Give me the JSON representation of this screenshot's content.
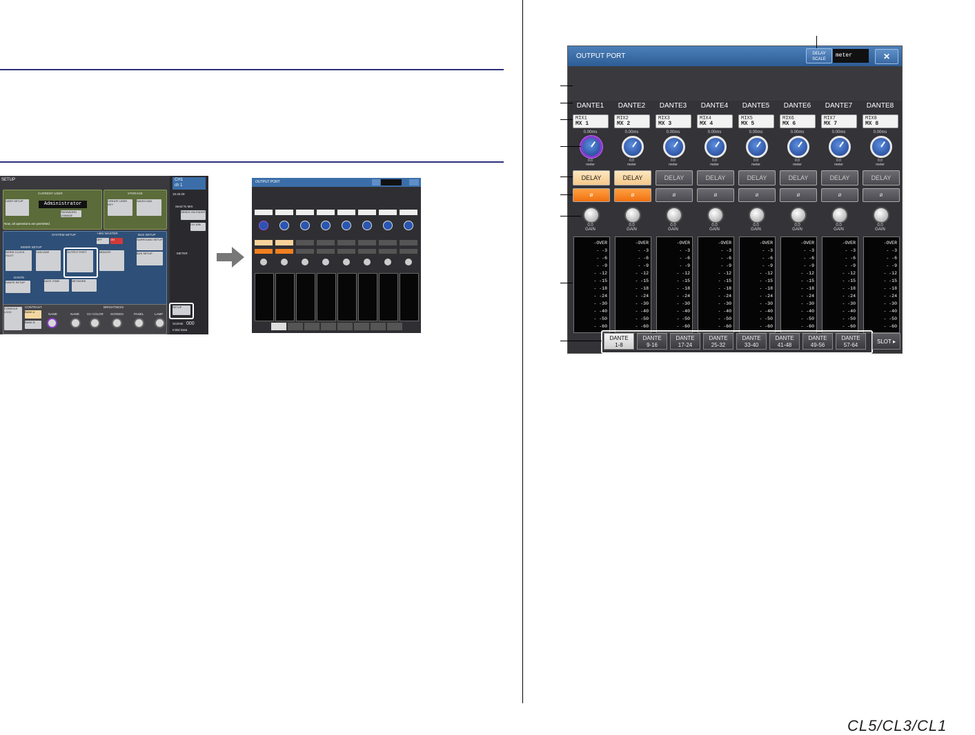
{
  "setup_screen": {
    "title": "SETUP",
    "current_user": "CURRENT USER",
    "storage": "STORAGE",
    "user_setup": "USER SETUP",
    "user_name": "Administrator",
    "password_change": "PASSWORD CHANGE",
    "create_user_key": "CREATE USER KEY",
    "save_load": "SAVE/LOAD",
    "permission_note": "Now, all operations are permitted.",
    "system_setup": "SYSTEM SETUP",
    "mixer_setup": "MIXER SETUP",
    "word_clock": "WORD CLOCK /SLOT",
    "cascade": "CASCADE",
    "output_port": "OUTPUT PORT",
    "midi_gpi": "MIDI/GPI",
    "plus48v_master": "+48V MASTER",
    "off": "OFF",
    "on": "ON",
    "bus_setup": "BUS SETUP",
    "surround_setup": "SURROUND SETUP",
    "bus_setup_btn": "BUS SETUP",
    "dante": "DANTE",
    "dante_setup": "DANTE SETUP",
    "date_time": "DATE /TIME",
    "network": "NETWORK",
    "console_lock": "CONSOLE LOCK",
    "contrast": "CONTRAST",
    "brightness": "BRIGHTNESS",
    "bank_a": "BANK A",
    "bank_b": "BANK B",
    "name": "NAME",
    "ch_color": "CH COLOR",
    "screen": "SCREEN",
    "panel": "PANEL",
    "lamp": "LAMP",
    "setup_btn": "SETUP",
    "ch_id": "CH1",
    "ch_name": "ch 1",
    "time": "15:46:29",
    "send_to_mix": "Send To MIX",
    "sends_on_fader": "SENDS ON FADER",
    "ch_job": "CH JOB",
    "meter": "METER",
    "scene": "SCENE",
    "scene_num": "000",
    "scene_name": "Initial Data"
  },
  "mini_window": {
    "title": "OUTPUT PORT"
  },
  "window": {
    "title": "OUTPUT PORT",
    "delay_scale_label": "DELAY SCALE",
    "delay_scale_value": "meter",
    "close_icon": "✕",
    "slot_label": "SLOT ▸"
  },
  "channels": [
    {
      "name": "DANTE1",
      "patch_top": "MIX1",
      "patch_bottom": "MX 1",
      "delay_time": "0.00ms",
      "delay_value": "0.0",
      "delay_unit": "meter",
      "delay_label": "DELAY",
      "phase_label": "ø",
      "gain_value": "0.0",
      "gain_label": "GAIN",
      "delay_on": true,
      "phase_on": true,
      "selected": true
    },
    {
      "name": "DANTE2",
      "patch_top": "MIX2",
      "patch_bottom": "MX 2",
      "delay_time": "0.00ms",
      "delay_value": "0.0",
      "delay_unit": "meter",
      "delay_label": "DELAY",
      "phase_label": "ø",
      "gain_value": "0.0",
      "gain_label": "GAIN",
      "delay_on": true,
      "phase_on": true,
      "selected": false
    },
    {
      "name": "DANTE3",
      "patch_top": "MIX3",
      "patch_bottom": "MX 3",
      "delay_time": "0.00ms",
      "delay_value": "0.0",
      "delay_unit": "meter",
      "delay_label": "DELAY",
      "phase_label": "ø",
      "gain_value": "0.0",
      "gain_label": "GAIN",
      "delay_on": false,
      "phase_on": false,
      "selected": false
    },
    {
      "name": "DANTE4",
      "patch_top": "MIX4",
      "patch_bottom": "MX 4",
      "delay_time": "0.00ms",
      "delay_value": "0.0",
      "delay_unit": "meter",
      "delay_label": "DELAY",
      "phase_label": "ø",
      "gain_value": "0.0",
      "gain_label": "GAIN",
      "delay_on": false,
      "phase_on": false,
      "selected": false
    },
    {
      "name": "DANTE5",
      "patch_top": "MIX5",
      "patch_bottom": "MX 5",
      "delay_time": "0.00ms",
      "delay_value": "0.0",
      "delay_unit": "meter",
      "delay_label": "DELAY",
      "phase_label": "ø",
      "gain_value": "0.0",
      "gain_label": "GAIN",
      "delay_on": false,
      "phase_on": false,
      "selected": false
    },
    {
      "name": "DANTE6",
      "patch_top": "MIX6",
      "patch_bottom": "MX 6",
      "delay_time": "0.00ms",
      "delay_value": "0.0",
      "delay_unit": "meter",
      "delay_label": "DELAY",
      "phase_label": "ø",
      "gain_value": "0.0",
      "gain_label": "GAIN",
      "delay_on": false,
      "phase_on": false,
      "selected": false
    },
    {
      "name": "DANTE7",
      "patch_top": "MIX7",
      "patch_bottom": "MX 7",
      "delay_time": "0.00ms",
      "delay_value": "0.0",
      "delay_unit": "meter",
      "delay_label": "DELAY",
      "phase_label": "ø",
      "gain_value": "0.0",
      "gain_label": "GAIN",
      "delay_on": false,
      "phase_on": false,
      "selected": false
    },
    {
      "name": "DANTE8",
      "patch_top": "MIX8",
      "patch_bottom": "MX 8",
      "delay_time": "0.00ms",
      "delay_value": "0.0",
      "delay_unit": "meter",
      "delay_label": "DELAY",
      "phase_label": "ø",
      "gain_value": "0.0",
      "gain_label": "GAIN",
      "delay_on": false,
      "phase_on": false,
      "selected": false
    }
  ],
  "meter_scale": [
    "-OVER",
    "- -3",
    "- -6",
    "- -9",
    "- -12",
    "- -15",
    "- -18",
    "- -24",
    "- -30",
    "- -40",
    "- -50",
    "- -60"
  ],
  "tabs": [
    {
      "top": "DANTE",
      "bottom": "1-8",
      "selected": true
    },
    {
      "top": "DANTE",
      "bottom": "9-16",
      "selected": false
    },
    {
      "top": "DANTE",
      "bottom": "17-24",
      "selected": false
    },
    {
      "top": "DANTE",
      "bottom": "25-32",
      "selected": false
    },
    {
      "top": "DANTE",
      "bottom": "33-40",
      "selected": false
    },
    {
      "top": "DANTE",
      "bottom": "41-48",
      "selected": false
    },
    {
      "top": "DANTE",
      "bottom": "49-56",
      "selected": false
    },
    {
      "top": "DANTE",
      "bottom": "57-64",
      "selected": false
    }
  ],
  "footer_brand": "CL5/CL3/CL1"
}
